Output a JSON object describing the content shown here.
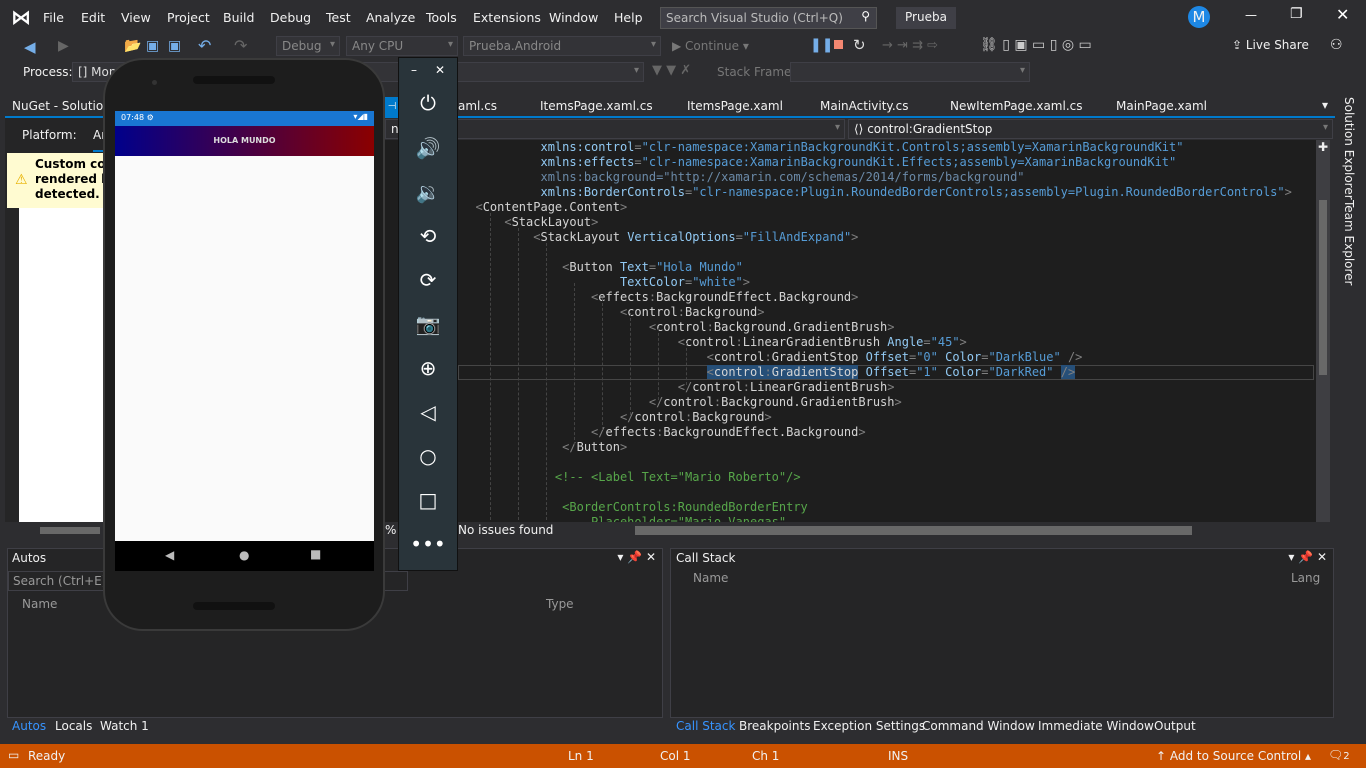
{
  "titlebar": {
    "menus": [
      "File",
      "Edit",
      "View",
      "Project",
      "Build",
      "Debug",
      "Test",
      "Analyze",
      "Tools",
      "Extensions",
      "Window",
      "Help"
    ],
    "search_placeholder": "Search Visual Studio (Ctrl+Q)",
    "solution_name": "Prueba",
    "avatar": "M"
  },
  "toolbar": {
    "config": "Debug",
    "platform": "Any CPU",
    "startup": "Prueba.Android",
    "continue": "Continue",
    "live_share": "Live Share",
    "process_label": "Process:",
    "process_value": "[] Mono",
    "stack_frame_label": "Stack Frame:"
  },
  "left_panel": {
    "tab": "NuGet - Solution",
    "platform_label": "Platform:",
    "platform_value": "An",
    "warning": [
      "Custom com",
      "rendered be",
      "detected."
    ]
  },
  "doc_tabs": [
    "aml.cs",
    "ItemsPage.xaml.cs",
    "ItemsPage.xaml",
    "MainActivity.cs",
    "NewItemPage.xaml.cs",
    "MainPage.xaml"
  ],
  "nav": {
    "left": "ntStop",
    "right": "control:GradientStop"
  },
  "code": {
    "lines": [
      [
        {
          "c": "at",
          "t": "           xmlns:control"
        },
        {
          "c": "br",
          "t": "="
        },
        {
          "c": "va",
          "t": "\"clr-namespace:XamarinBackgroundKit.Controls;assembly=XamarinBackgroundKit\""
        }
      ],
      [
        {
          "c": "at",
          "t": "           xmlns:effects"
        },
        {
          "c": "br",
          "t": "="
        },
        {
          "c": "va",
          "t": "\"clr-namespace:XamarinBackgroundKit.Effects;assembly=XamarinBackgroundKit\""
        }
      ],
      [
        {
          "c": "dim",
          "t": "           xmlns:background=\"http://xamarin.com/schemas/2014/forms/background\""
        }
      ],
      [
        {
          "c": "at",
          "t": "           xmlns:BorderControls"
        },
        {
          "c": "br",
          "t": "="
        },
        {
          "c": "va",
          "t": "\"clr-namespace:Plugin.RoundedBorderControls;assembly=Plugin.RoundedBorderControls\""
        },
        {
          "c": "br",
          "t": ">"
        }
      ],
      [
        {
          "c": "br",
          "t": "  <"
        },
        {
          "c": "tg",
          "t": "ContentPage.Content"
        },
        {
          "c": "br",
          "t": ">"
        }
      ],
      [
        {
          "c": "br",
          "t": "      <"
        },
        {
          "c": "tg",
          "t": "StackLayout"
        },
        {
          "c": "br",
          "t": ">"
        }
      ],
      [
        {
          "c": "br",
          "t": "          <"
        },
        {
          "c": "tg",
          "t": "StackLayout "
        },
        {
          "c": "at",
          "t": "VerticalOptions"
        },
        {
          "c": "br",
          "t": "="
        },
        {
          "c": "va",
          "t": "\"FillAndExpand\""
        },
        {
          "c": "br",
          "t": ">"
        }
      ],
      [
        {
          "c": "tg",
          "t": ""
        }
      ],
      [
        {
          "c": "br",
          "t": "              <"
        },
        {
          "c": "tg",
          "t": "Button "
        },
        {
          "c": "at",
          "t": "Text"
        },
        {
          "c": "br",
          "t": "="
        },
        {
          "c": "va",
          "t": "\"Hola Mundo\""
        }
      ],
      [
        {
          "c": "at",
          "t": "                      TextColor"
        },
        {
          "c": "br",
          "t": "="
        },
        {
          "c": "va",
          "t": "\"white\""
        },
        {
          "c": "br",
          "t": ">"
        }
      ],
      [
        {
          "c": "br",
          "t": "                  <"
        },
        {
          "c": "tg",
          "t": "effects"
        },
        {
          "c": "br",
          "t": ":"
        },
        {
          "c": "tg",
          "t": "BackgroundEffect.Background"
        },
        {
          "c": "br",
          "t": ">"
        }
      ],
      [
        {
          "c": "br",
          "t": "                      <"
        },
        {
          "c": "tg",
          "t": "control"
        },
        {
          "c": "br",
          "t": ":"
        },
        {
          "c": "tg",
          "t": "Background"
        },
        {
          "c": "br",
          "t": ">"
        }
      ],
      [
        {
          "c": "br",
          "t": "                          <"
        },
        {
          "c": "tg",
          "t": "control"
        },
        {
          "c": "br",
          "t": ":"
        },
        {
          "c": "tg",
          "t": "Background.GradientBrush"
        },
        {
          "c": "br",
          "t": ">"
        }
      ],
      [
        {
          "c": "br",
          "t": "                              <"
        },
        {
          "c": "tg",
          "t": "control"
        },
        {
          "c": "br",
          "t": ":"
        },
        {
          "c": "tg",
          "t": "LinearGradientBrush "
        },
        {
          "c": "at",
          "t": "Angle"
        },
        {
          "c": "br",
          "t": "="
        },
        {
          "c": "va",
          "t": "\"45\""
        },
        {
          "c": "br",
          "t": ">"
        }
      ],
      [
        {
          "c": "br",
          "t": "                                  <"
        },
        {
          "c": "tg",
          "t": "control"
        },
        {
          "c": "br",
          "t": ":"
        },
        {
          "c": "tg",
          "t": "GradientStop "
        },
        {
          "c": "at",
          "t": "Offset"
        },
        {
          "c": "br",
          "t": "="
        },
        {
          "c": "va",
          "t": "\"0\" "
        },
        {
          "c": "at",
          "t": "Color"
        },
        {
          "c": "br",
          "t": "="
        },
        {
          "c": "va",
          "t": "\"DarkBlue\" "
        },
        {
          "c": "br",
          "t": "/>"
        }
      ],
      [
        {
          "c": "tg",
          "t": "                                  "
        },
        {
          "c": "br sel",
          "t": "<"
        },
        {
          "c": "tg sel",
          "t": "control"
        },
        {
          "c": "br sel",
          "t": ":"
        },
        {
          "c": "tg sel",
          "t": "GradientStop"
        },
        {
          "c": "at",
          "t": " Offset"
        },
        {
          "c": "br",
          "t": "="
        },
        {
          "c": "va",
          "t": "\"1\" "
        },
        {
          "c": "at",
          "t": "Color"
        },
        {
          "c": "br",
          "t": "="
        },
        {
          "c": "va",
          "t": "\"DarkRed\" "
        },
        {
          "c": "br sel",
          "t": "/>"
        }
      ],
      [
        {
          "c": "br",
          "t": "                              </"
        },
        {
          "c": "tg",
          "t": "control"
        },
        {
          "c": "br",
          "t": ":"
        },
        {
          "c": "tg",
          "t": "LinearGradientBrush"
        },
        {
          "c": "br",
          "t": ">"
        }
      ],
      [
        {
          "c": "br",
          "t": "                          </"
        },
        {
          "c": "tg",
          "t": "control"
        },
        {
          "c": "br",
          "t": ":"
        },
        {
          "c": "tg",
          "t": "Background.GradientBrush"
        },
        {
          "c": "br",
          "t": ">"
        }
      ],
      [
        {
          "c": "br",
          "t": "                      </"
        },
        {
          "c": "tg",
          "t": "control"
        },
        {
          "c": "br",
          "t": ":"
        },
        {
          "c": "tg",
          "t": "Background"
        },
        {
          "c": "br",
          "t": ">"
        }
      ],
      [
        {
          "c": "br",
          "t": "                  </"
        },
        {
          "c": "tg",
          "t": "effects"
        },
        {
          "c": "br",
          "t": ":"
        },
        {
          "c": "tg",
          "t": "BackgroundEffect.Background"
        },
        {
          "c": "br",
          "t": ">"
        }
      ],
      [
        {
          "c": "br",
          "t": "              </"
        },
        {
          "c": "tg",
          "t": "Button"
        },
        {
          "c": "br",
          "t": ">"
        }
      ],
      [
        {
          "c": "tg",
          "t": ""
        }
      ],
      [
        {
          "c": "cm",
          "t": "             <!-- <Label Text=\"Mario Roberto\"/>"
        }
      ],
      [
        {
          "c": "tg",
          "t": ""
        }
      ],
      [
        {
          "c": "cm",
          "t": "              <BorderControls:RoundedBorderEntry"
        }
      ],
      [
        {
          "c": "cm",
          "t": "                  Placeholder=\"Mario Vanegas\""
        }
      ]
    ]
  },
  "editor_status": {
    "zoom_suffix": "%",
    "issues": "No issues found"
  },
  "side_tabs": [
    "Solution Explorer",
    "Team Explorer"
  ],
  "autos": {
    "title": "Autos",
    "search": "Search (Ctrl+E)",
    "columns": [
      "Name",
      "Type"
    ],
    "tabs": [
      "Autos",
      "Locals",
      "Watch 1"
    ]
  },
  "callstack": {
    "title": "Call Stack",
    "columns": [
      "Name",
      "Lang"
    ],
    "tabs": [
      "Call Stack",
      "Breakpoints",
      "Exception Settings",
      "Command Window",
      "Immediate Window",
      "Output"
    ]
  },
  "statusbar": {
    "ready": "Ready",
    "ln": "Ln 1",
    "col": "Col 1",
    "ch": "Ch 1",
    "mode": "INS",
    "source_control": "Add to Source Control",
    "notifications": "2"
  },
  "emulator": {
    "time": "07:48",
    "app_title": "HOLA MUNDO",
    "gradient_from": "#00008b",
    "gradient_to": "#8b0000"
  }
}
